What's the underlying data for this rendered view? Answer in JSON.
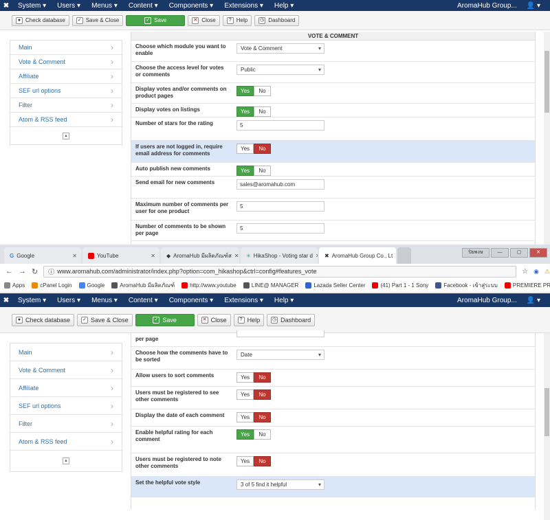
{
  "top": {
    "navbar": {
      "menu": [
        "System ▾",
        "Users ▾",
        "Menus ▾",
        "Content ▾",
        "Components ▾",
        "Extensions ▾",
        "Help ▾"
      ],
      "site_link": "AromaHub Group...",
      "user": "▾"
    },
    "toolbar": {
      "check_database": "Check database",
      "save_close": "Save & Close",
      "save": "Save",
      "close": "Close",
      "help": "Help",
      "dashboard": "Dashboard"
    },
    "sidebar": [
      "Main",
      "Vote & Comment",
      "Affiliate",
      "SEF url options",
      "Filter",
      "Atom & RSS feed"
    ],
    "panel_title": "VOTE & COMMENT",
    "rows": [
      {
        "label": "Choose which module you want to enable",
        "type": "select",
        "value": "Vote & Comment"
      },
      {
        "label": "Choose the access level for votes or comments",
        "type": "select",
        "value": "Public"
      },
      {
        "label": "Display votes and/or comments on product pages",
        "type": "yesno",
        "value": "Yes"
      },
      {
        "label": "Display votes on listings",
        "type": "yesno",
        "value": "Yes"
      },
      {
        "label": "Number of stars for the rating",
        "type": "text",
        "value": "5"
      },
      {
        "label": "If users are not logged in, require email address for comments",
        "type": "yesno",
        "value": "No",
        "highlighted": true
      },
      {
        "label": "Auto publish new comments",
        "type": "yesno",
        "value": "Yes"
      },
      {
        "label": "Send email for new comments",
        "type": "text",
        "value": "sales@aromahub.com"
      },
      {
        "label": "Maximum number of comments per user for one product",
        "type": "text",
        "value": "5"
      },
      {
        "label": "Number of comments to be shown per page",
        "type": "text",
        "value": "5"
      }
    ]
  },
  "browser": {
    "tabs": [
      "Google",
      "YouTube",
      "AromaHub มีผลิตภัณฑ์ส",
      "HikaShop - Voting star d",
      "AromaHub Group Co., Lt"
    ],
    "window_user": "ปิยพงษ",
    "url": "www.aromahub.com/administrator/index.php?option=com_hikashop&ctrl=config#features_vote",
    "bookmarks": [
      "Apps",
      "cPanel Login",
      "Google",
      "AromaHub มีผลิตภัณฑ์",
      "http://www.youtube",
      "LINE@ MANAGER",
      "Lazada Seller Center",
      "(41) Part 1 - 1 Sony",
      "Facebook - เข้าสู่ระบบ",
      "PREMIERE PRO TUTO"
    ],
    "more": "»"
  },
  "bottom": {
    "navbar": {
      "menu": [
        "System ▾",
        "Users ▾",
        "Menus ▾",
        "Content ▾",
        "Components ▾",
        "Extensions ▾",
        "Help ▾"
      ],
      "site_link": "AromaHub Group...",
      "user": "▾"
    },
    "toolbar": {
      "check_database": "Check database",
      "save_close": "Save & Close",
      "save": "Save",
      "close": "Close",
      "help": "Help",
      "dashboard": "Dashboard"
    },
    "sidebar": [
      "Main",
      "Vote & Comment",
      "Affiliate",
      "SEF url options",
      "Filter",
      "Atom & RSS feed"
    ],
    "cut_label": "per page",
    "rows": [
      {
        "label": "Choose how the comments have to be sorted",
        "type": "select",
        "value": "Date"
      },
      {
        "label": "Allow users to sort comments",
        "type": "yesno",
        "value": "No"
      },
      {
        "label": "Users must be registered to see other comments",
        "type": "yesno",
        "value": "No"
      },
      {
        "label": "Display the date of each comment",
        "type": "yesno",
        "value": "No"
      },
      {
        "label": "Enable helpful rating for each comment",
        "type": "yesno",
        "value": "Yes"
      },
      {
        "label": "Users must be registered to note other comments",
        "type": "yesno",
        "value": "No"
      },
      {
        "label": "Set the helpful vote style",
        "type": "select",
        "value": "3 of 5 find it helpful",
        "highlighted": true
      }
    ]
  },
  "yes_label": "Yes",
  "no_label": "No",
  "colors": {
    "navbar": "#1a3867",
    "save_green": "#46a546",
    "no_red": "#bd362f",
    "highlight_row": "#d9e7f9",
    "link": "#3071a9"
  }
}
